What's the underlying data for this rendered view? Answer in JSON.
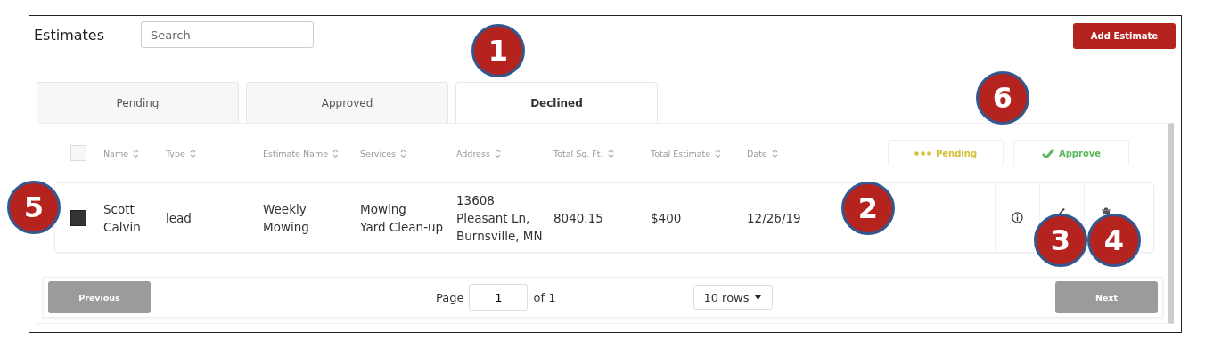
{
  "title": "Estimates",
  "search": {
    "placeholder": "Search"
  },
  "add_button": "Add Estimate",
  "tabs": [
    {
      "label": "Pending",
      "selected": false
    },
    {
      "label": "Approved",
      "selected": false
    },
    {
      "label": "Declined",
      "selected": true
    }
  ],
  "table": {
    "select_all": {
      "checked": false
    },
    "columns": [
      "Name",
      "Type",
      "Estimate Name",
      "Services",
      "Address",
      "Total Sq. Ft.",
      "Total Estimate",
      "Date"
    ],
    "bulk_actions": [
      {
        "kind": "pending",
        "label": "Pending"
      },
      {
        "kind": "approve",
        "label": "Approve"
      }
    ],
    "rows": [
      {
        "checked": true,
        "cells": [
          [
            "Scott",
            "Calvin"
          ],
          [
            "lead"
          ],
          [
            "Weekly",
            "Mowing"
          ],
          [
            "Mowing",
            "Yard Clean-up"
          ],
          [
            "13608",
            "Pleasant Ln,",
            "Burnsville, MN"
          ],
          [
            "8040.15"
          ],
          [
            "$400"
          ],
          [
            "12/26/19"
          ]
        ]
      }
    ]
  },
  "pagination": {
    "previous": "Previous",
    "page_label": "Page",
    "page": "1",
    "of": "of 1",
    "rows": "10 rows",
    "next": "Next"
  },
  "callouts": [
    "1",
    "2",
    "3",
    "4",
    "5",
    "6"
  ]
}
